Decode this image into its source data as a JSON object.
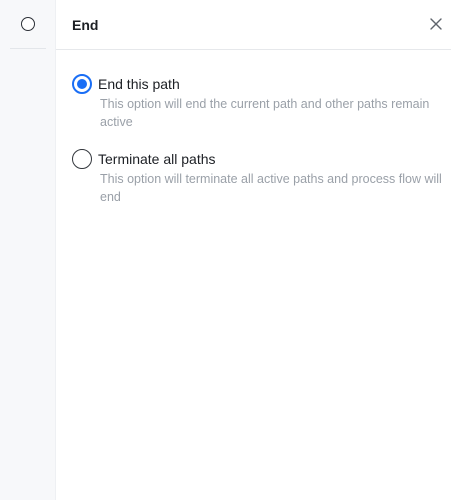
{
  "rail": {
    "node_icon": "circle-outline-icon"
  },
  "panel": {
    "title": "End",
    "close_icon": "close-icon"
  },
  "options": [
    {
      "label": "End this path",
      "description": "This option will end the current path and other paths remain active",
      "selected": true
    },
    {
      "label": "Terminate all paths",
      "description": "This option will terminate all active paths and process flow will end",
      "selected": false
    }
  ],
  "colors": {
    "accent": "#1a6ef5",
    "text": "#1c1f24",
    "muted": "#9aa0a8"
  }
}
